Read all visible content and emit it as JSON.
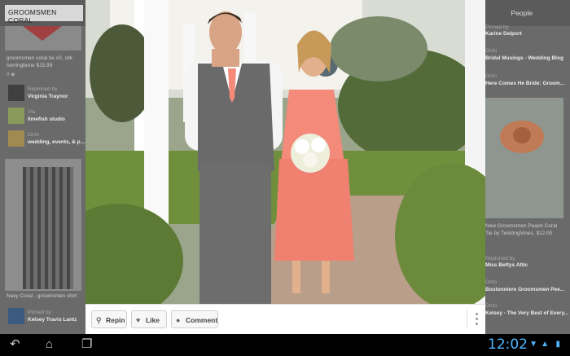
{
  "search": {
    "value": "GROOMSMEN CORAL"
  },
  "header": {
    "people_tab": "People"
  },
  "left_feed": {
    "pin_title": "groomsmen coral tie #2, silk herringbone $15.99",
    "pin_title_line1": "groomsmen coral tie #2, silk",
    "pin_title_line2": "herringbone $15.99",
    "stats": "8  ◆",
    "repins": [
      {
        "kind": "Repinned by",
        "name": "Virginia Traynor"
      },
      {
        "kind": "Via",
        "name": "limefish studio"
      },
      {
        "kind": "Onto",
        "name": "wedding, events, & p..."
      }
    ],
    "bottom_title": "Navy Coral - groomsmen shirt",
    "bottom_pinner_kind": "Pinned by",
    "bottom_pinner": "Kelsey Travis Lantz"
  },
  "right_feed": {
    "items": [
      "Pinned by",
      "Karine Delport",
      "Onto",
      "Bridal Musings - Wedding Blog",
      "Onto",
      "Here Comes He Bride: Groom..."
    ],
    "pin_title_line1": "New Groomsmen Peach Coral",
    "pin_title_line2": "Tie by TwistingVines, $12.00",
    "repins": [
      {
        "kind": "Repinned by",
        "name": "Miss Bettys Attic"
      },
      {
        "kind": "Onto",
        "name": "Boutonniere Groomsmen Pee..."
      },
      {
        "kind": "Onto",
        "name": "Kelsey - The Very Best of Every..."
      }
    ]
  },
  "actions": {
    "repin": "Repin",
    "like": "Like",
    "comment": "Comment"
  },
  "status": {
    "clock": "12:02"
  },
  "colors": {
    "dress": "#f38a7a",
    "vest": "#6a6a6a",
    "accent_blue": "#4fb6ff"
  }
}
